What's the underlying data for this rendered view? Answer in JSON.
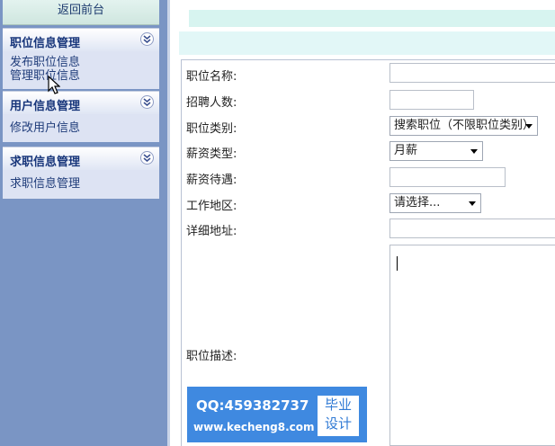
{
  "sidebar": {
    "back_link": "返回前台",
    "sections": [
      {
        "title": "职位信息管理",
        "items": [
          "发布职位信息",
          "管理职位信息"
        ]
      },
      {
        "title": "用户信息管理",
        "items": [
          "修改用户信息"
        ]
      },
      {
        "title": "求职信息管理",
        "items": [
          "求职信息管理"
        ]
      }
    ]
  },
  "form": {
    "job_name": {
      "label": "职位名称:",
      "value": ""
    },
    "headcount": {
      "label": "招聘人数:",
      "value": ""
    },
    "job_category": {
      "label": "职位类别:",
      "selected": "搜索职位（不限职位类别）"
    },
    "salary_type": {
      "label": "薪资类型:",
      "selected": "月薪"
    },
    "salary": {
      "label": "薪资待遇:",
      "value": ""
    },
    "work_area": {
      "label": "工作地区:",
      "selected": "请选择..."
    },
    "address": {
      "label": "详细地址:",
      "value": ""
    },
    "description": {
      "label": "职位描述:",
      "value": ""
    }
  },
  "watermark": {
    "qq": "QQ:459382737",
    "site": "www.kecheng8.com",
    "badge_line1": "毕业",
    "badge_line2": "设计"
  },
  "colors": {
    "sidebar_bg": "#7a95c4",
    "menu_title": "#17357a",
    "watermark_bg": "#3f89e0"
  },
  "icons": [
    "chevron-double-down-icon",
    "dropdown-arrow-icon",
    "mouse-cursor-icon"
  ]
}
